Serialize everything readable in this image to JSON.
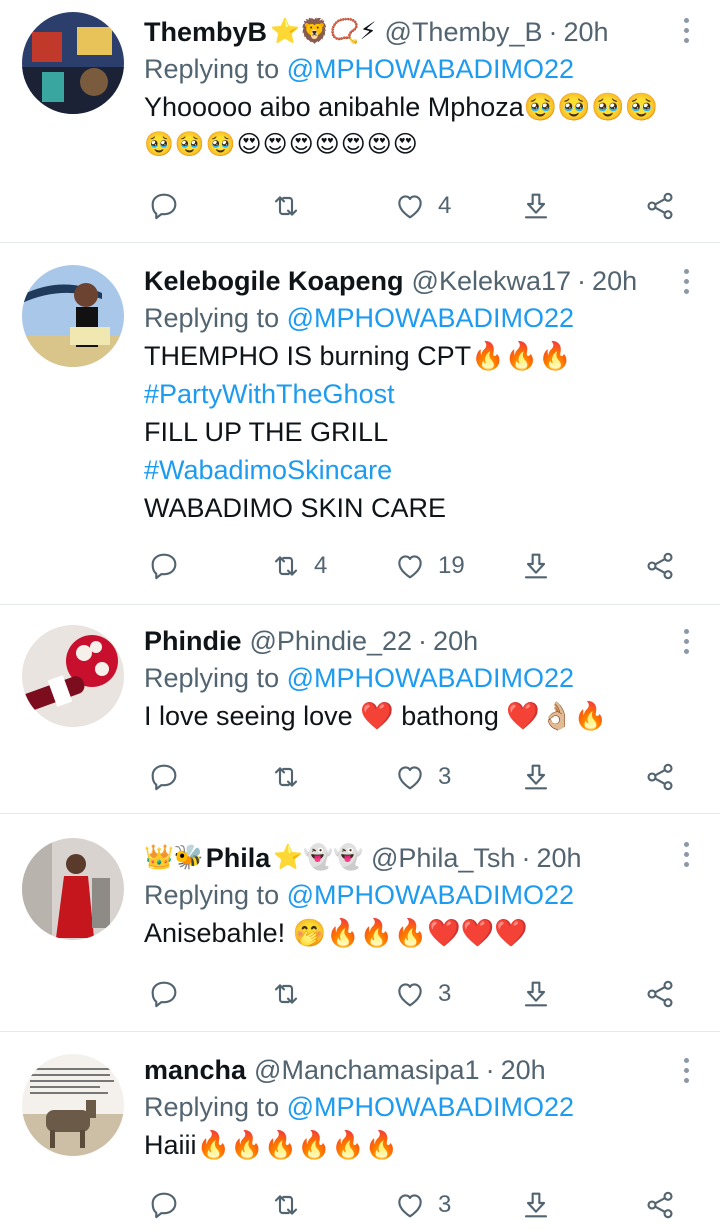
{
  "colors": {
    "link": "#1d9bf0",
    "muted": "#536471",
    "text": "#0f1419"
  },
  "tweets": [
    {
      "name": "ThembyB",
      "name_decor": "⭐🦁📿⚡",
      "handle": "@Themby_B",
      "time": "20h",
      "reply_prefix": "Replying to",
      "reply_to": "@MPHOWABADIMO22",
      "lines": [
        "Yhooooo aibo anibahle Mphoza🥹🥹🥹🥹",
        "🥹🥹🥹😍😍😍😍😍😍😍"
      ],
      "counts": {
        "reply": "",
        "retweet": "",
        "like": "4"
      }
    },
    {
      "name": "Kelebogile Koapeng",
      "name_decor": "",
      "handle": "@Kelekwa17",
      "time": "20h",
      "reply_prefix": "Replying to",
      "reply_to": "@MPHOWABADIMO22",
      "lines": [
        "THEMPHO IS burning CPT🔥🔥🔥",
        "#PartyWithTheGhost",
        "FILL UP THE GRILL",
        "#WabadimoSkincare",
        "WABADIMO SKIN CARE"
      ],
      "counts": {
        "reply": "",
        "retweet": "4",
        "like": "19"
      }
    },
    {
      "name": "Phindie",
      "name_decor": "",
      "handle": "@Phindie_22",
      "time": "20h",
      "reply_prefix": "Replying to",
      "reply_to": "@MPHOWABADIMO22",
      "lines": [
        "I love seeing love ❤️ bathong ❤️👌🏼🔥"
      ],
      "counts": {
        "reply": "",
        "retweet": "",
        "like": "3"
      }
    },
    {
      "name": "Phila",
      "name_prefix": "👑🐝",
      "name_decor": "⭐👻👻",
      "handle": "@Phila_Tsh",
      "time": "20h",
      "reply_prefix": "Replying to",
      "reply_to": "@MPHOWABADIMO22",
      "lines": [
        "Anisebahle! 🤭🔥🔥🔥❤️❤️❤️"
      ],
      "counts": {
        "reply": "",
        "retweet": "",
        "like": "3"
      }
    },
    {
      "name": "mancha",
      "name_decor": "",
      "handle": "@Manchamasipa1",
      "time": "20h",
      "reply_prefix": "Replying to",
      "reply_to": "@MPHOWABADIMO22",
      "lines": [
        "Haiii🔥🔥🔥🔥🔥🔥"
      ],
      "counts": {
        "reply": "",
        "retweet": "",
        "like": "3"
      }
    }
  ],
  "icons": [
    "reply-icon",
    "retweet-icon",
    "like-icon",
    "download-icon",
    "share-icon",
    "more-icon"
  ]
}
